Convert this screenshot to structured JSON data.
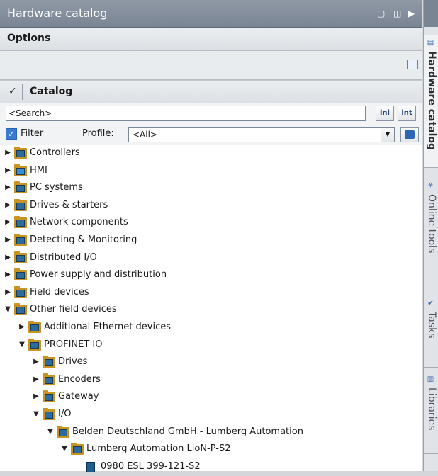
{
  "window": {
    "title": "Hardware catalog"
  },
  "options": {
    "header": "Options"
  },
  "catalog": {
    "header": "Catalog",
    "search_value": "<Search>",
    "search_down_label": "ini",
    "search_up_label": "int",
    "filter_label": "Filter",
    "filter_checked": true,
    "profile_label": "Profile:",
    "profile_value": "<All>"
  },
  "tree": [
    {
      "label": "Controllers",
      "expanded": false,
      "depth": 0,
      "icon": "folder-icon"
    },
    {
      "label": "HMI",
      "expanded": false,
      "depth": 0,
      "icon": "folder-hmi-icon"
    },
    {
      "label": "PC systems",
      "expanded": false,
      "depth": 0,
      "icon": "folder-icon"
    },
    {
      "label": "Drives & starters",
      "expanded": false,
      "depth": 0,
      "icon": "folder-icon"
    },
    {
      "label": "Network components",
      "expanded": false,
      "depth": 0,
      "icon": "folder-icon"
    },
    {
      "label": "Detecting & Monitoring",
      "expanded": false,
      "depth": 0,
      "icon": "folder-icon"
    },
    {
      "label": "Distributed I/O",
      "expanded": false,
      "depth": 0,
      "icon": "folder-icon"
    },
    {
      "label": "Power supply and distribution",
      "expanded": false,
      "depth": 0,
      "icon": "folder-icon"
    },
    {
      "label": "Field devices",
      "expanded": false,
      "depth": 0,
      "icon": "folder-icon"
    },
    {
      "label": "Other field devices",
      "expanded": true,
      "depth": 0,
      "icon": "folder-icon"
    },
    {
      "label": "Additional Ethernet devices",
      "expanded": false,
      "depth": 1,
      "icon": "folder-icon"
    },
    {
      "label": "PROFINET IO",
      "expanded": true,
      "depth": 1,
      "icon": "folder-icon"
    },
    {
      "label": "Drives",
      "expanded": false,
      "depth": 2,
      "icon": "folder-icon"
    },
    {
      "label": "Encoders",
      "expanded": false,
      "depth": 2,
      "icon": "folder-icon"
    },
    {
      "label": "Gateway",
      "expanded": false,
      "depth": 2,
      "icon": "folder-icon"
    },
    {
      "label": "I/O",
      "expanded": true,
      "depth": 2,
      "icon": "folder-icon"
    },
    {
      "label": "Belden Deutschland GmbH - Lumberg Automation",
      "expanded": true,
      "depth": 3,
      "icon": "folder-icon"
    },
    {
      "label": "Lumberg Automation LioN-P-S2",
      "expanded": true,
      "depth": 4,
      "icon": "folder-icon"
    },
    {
      "label": "0980 ESL 399-121-S2",
      "expanded": null,
      "depth": 5,
      "icon": "device-module-icon"
    }
  ],
  "sidebar_tabs": [
    {
      "label": "Hardware catalog",
      "icon": "catalog-tab-icon",
      "active": true
    },
    {
      "label": "Online tools",
      "icon": "online-tools-icon",
      "active": false
    },
    {
      "label": "Tasks",
      "icon": "tasks-icon",
      "active": false
    },
    {
      "label": "Libraries",
      "icon": "libraries-icon",
      "active": false
    }
  ]
}
